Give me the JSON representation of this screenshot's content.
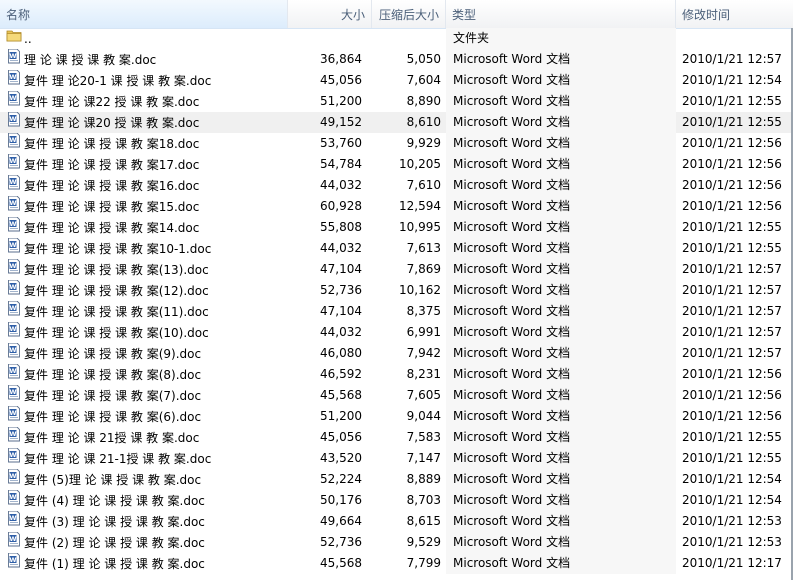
{
  "header": {
    "name": "名称",
    "size": "大小",
    "compressed": "压缩后大小",
    "type": "类型",
    "modified": "修改时间"
  },
  "rows": [
    {
      "name": "..",
      "size": "",
      "csize": "",
      "type": "文件夹",
      "date": "",
      "icon": "folder-icon"
    },
    {
      "name": "理 论 课 授 课 教 案.doc",
      "size": "36,864",
      "csize": "5,050",
      "type": "Microsoft Word 文档",
      "date": "2010/1/21 12:57",
      "icon": "word-doc-icon"
    },
    {
      "name": "复件 理 论20-1 课 授 课 教 案.doc",
      "size": "45,056",
      "csize": "7,604",
      "type": "Microsoft Word 文档",
      "date": "2010/1/21 12:54",
      "icon": "word-doc-icon"
    },
    {
      "name": "复件 理 论 课22 授 课 教 案.doc",
      "size": "51,200",
      "csize": "8,890",
      "type": "Microsoft Word 文档",
      "date": "2010/1/21 12:55",
      "icon": "word-doc-icon"
    },
    {
      "name": "复件 理 论 课20 授 课 教 案.doc",
      "size": "49,152",
      "csize": "8,610",
      "type": "Microsoft Word 文档",
      "date": "2010/1/21 12:55",
      "icon": "word-doc-icon",
      "selected": true
    },
    {
      "name": "复件 理 论 课 授 课 教 案18.doc",
      "size": "53,760",
      "csize": "9,929",
      "type": "Microsoft Word 文档",
      "date": "2010/1/21 12:56",
      "icon": "word-doc-icon"
    },
    {
      "name": "复件 理 论 课 授 课 教 案17.doc",
      "size": "54,784",
      "csize": "10,205",
      "type": "Microsoft Word 文档",
      "date": "2010/1/21 12:56",
      "icon": "word-doc-icon"
    },
    {
      "name": "复件 理 论 课 授 课 教 案16.doc",
      "size": "44,032",
      "csize": "7,610",
      "type": "Microsoft Word 文档",
      "date": "2010/1/21 12:56",
      "icon": "word-doc-icon"
    },
    {
      "name": "复件 理 论 课 授 课 教 案15.doc",
      "size": "60,928",
      "csize": "12,594",
      "type": "Microsoft Word 文档",
      "date": "2010/1/21 12:56",
      "icon": "word-doc-icon"
    },
    {
      "name": "复件 理 论 课 授 课 教 案14.doc",
      "size": "55,808",
      "csize": "10,995",
      "type": "Microsoft Word 文档",
      "date": "2010/1/21 12:55",
      "icon": "word-doc-icon"
    },
    {
      "name": "复件 理 论 课 授 课 教 案10-1.doc",
      "size": "44,032",
      "csize": "7,613",
      "type": "Microsoft Word 文档",
      "date": "2010/1/21 12:55",
      "icon": "word-doc-icon"
    },
    {
      "name": "复件 理 论 课 授 课 教 案(13).doc",
      "size": "47,104",
      "csize": "7,869",
      "type": "Microsoft Word 文档",
      "date": "2010/1/21 12:57",
      "icon": "word-doc-icon"
    },
    {
      "name": "复件 理 论 课 授 课 教 案(12).doc",
      "size": "52,736",
      "csize": "10,162",
      "type": "Microsoft Word 文档",
      "date": "2010/1/21 12:57",
      "icon": "word-doc-icon"
    },
    {
      "name": "复件 理 论 课 授 课 教 案(11).doc",
      "size": "47,104",
      "csize": "8,375",
      "type": "Microsoft Word 文档",
      "date": "2010/1/21 12:57",
      "icon": "word-doc-icon"
    },
    {
      "name": "复件 理 论 课 授 课 教 案(10).doc",
      "size": "44,032",
      "csize": "6,991",
      "type": "Microsoft Word 文档",
      "date": "2010/1/21 12:57",
      "icon": "word-doc-icon"
    },
    {
      "name": "复件 理 论 课 授 课 教 案(9).doc",
      "size": "46,080",
      "csize": "7,942",
      "type": "Microsoft Word 文档",
      "date": "2010/1/21 12:57",
      "icon": "word-doc-icon"
    },
    {
      "name": "复件 理 论 课 授 课 教 案(8).doc",
      "size": "46,592",
      "csize": "8,231",
      "type": "Microsoft Word 文档",
      "date": "2010/1/21 12:56",
      "icon": "word-doc-icon"
    },
    {
      "name": "复件 理 论 课 授 课 教 案(7).doc",
      "size": "45,568",
      "csize": "7,605",
      "type": "Microsoft Word 文档",
      "date": "2010/1/21 12:56",
      "icon": "word-doc-icon"
    },
    {
      "name": "复件 理 论 课 授 课 教 案(6).doc",
      "size": "51,200",
      "csize": "9,044",
      "type": "Microsoft Word 文档",
      "date": "2010/1/21 12:56",
      "icon": "word-doc-icon"
    },
    {
      "name": "复件 理 论 课 21授 课 教 案.doc",
      "size": "45,056",
      "csize": "7,583",
      "type": "Microsoft Word 文档",
      "date": "2010/1/21 12:55",
      "icon": "word-doc-icon"
    },
    {
      "name": "复件 理 论 课 21-1授 课 教 案.doc",
      "size": "43,520",
      "csize": "7,147",
      "type": "Microsoft Word 文档",
      "date": "2010/1/21 12:55",
      "icon": "word-doc-icon"
    },
    {
      "name": "复件 (5)理 论 课 授 课 教 案.doc",
      "size": "52,224",
      "csize": "8,889",
      "type": "Microsoft Word 文档",
      "date": "2010/1/21 12:54",
      "icon": "word-doc-icon"
    },
    {
      "name": "复件 (4) 理 论 课 授 课 教 案.doc",
      "size": "50,176",
      "csize": "8,703",
      "type": "Microsoft Word 文档",
      "date": "2010/1/21 12:54",
      "icon": "word-doc-icon"
    },
    {
      "name": "复件 (3) 理 论 课 授 课 教 案.doc",
      "size": "49,664",
      "csize": "8,615",
      "type": "Microsoft Word 文档",
      "date": "2010/1/21 12:53",
      "icon": "word-doc-icon"
    },
    {
      "name": "复件 (2) 理 论 课 授 课 教 案.doc",
      "size": "52,736",
      "csize": "9,529",
      "type": "Microsoft Word 文档",
      "date": "2010/1/21 12:53",
      "icon": "word-doc-icon"
    },
    {
      "name": "复件 (1) 理 论 课 授 课 教 案.doc",
      "size": "45,568",
      "csize": "7,799",
      "type": "Microsoft Word 文档",
      "date": "2010/1/21 12:17",
      "icon": "word-doc-icon"
    }
  ]
}
